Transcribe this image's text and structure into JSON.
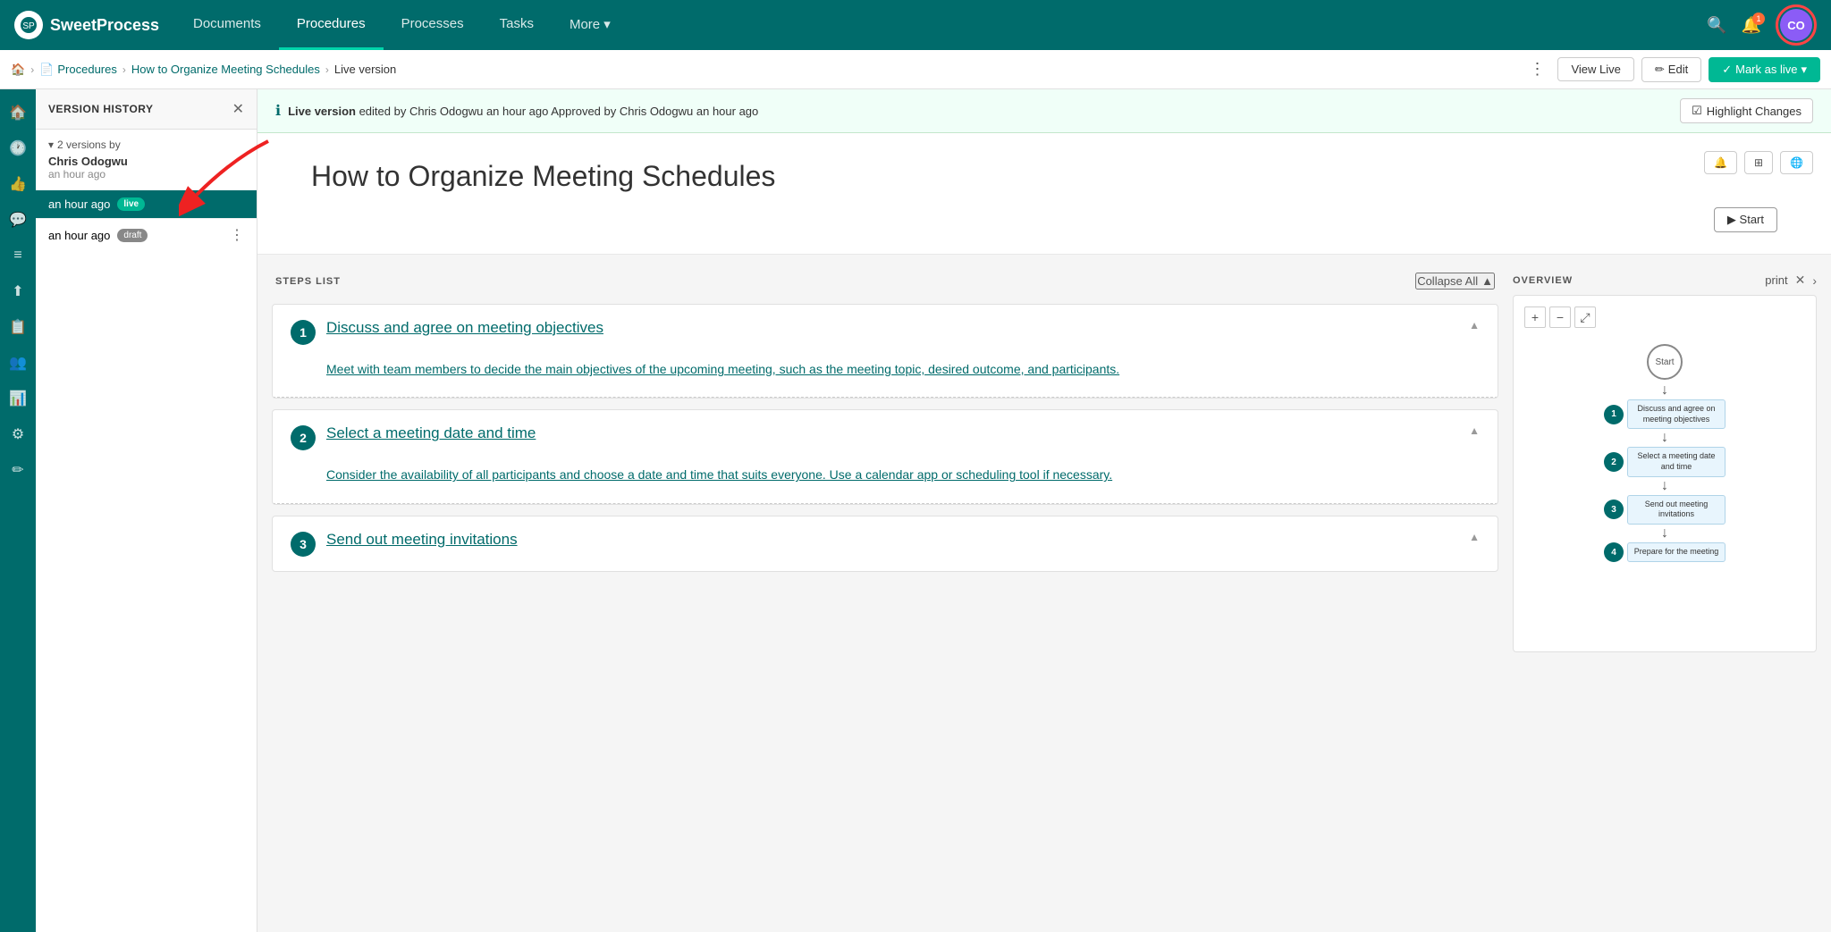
{
  "topnav": {
    "logo": "SweetProcess",
    "links": [
      {
        "label": "Documents",
        "active": false
      },
      {
        "label": "Procedures",
        "active": true
      },
      {
        "label": "Processes",
        "active": false
      },
      {
        "label": "Tasks",
        "active": false
      },
      {
        "label": "More",
        "active": false,
        "hasDropdown": true
      }
    ],
    "notification_count": "1",
    "avatar_initials": "CO"
  },
  "breadcrumb": {
    "home": "Home",
    "procedures": "Procedures",
    "document": "How to Organize Meeting Schedules",
    "current": "Live version"
  },
  "toolbar": {
    "view_live": "View Live",
    "edit": "Edit",
    "mark_as_live": "Mark as live",
    "dots": "⋮"
  },
  "version_panel": {
    "title": "VERSION HISTORY",
    "group_label": "2 versions by",
    "author": "Chris Odogwu",
    "time_ago": "an hour ago",
    "versions": [
      {
        "time": "an hour ago",
        "badge": "live",
        "active": true
      },
      {
        "time": "an hour ago",
        "badge": "draft",
        "active": false
      }
    ]
  },
  "info_banner": {
    "message_prefix": "Live version",
    "message_mid": "edited by Chris Odogwu",
    "message_time1": "an hour ago",
    "message_sep": "Approved by Chris Odogwu",
    "message_time2": "an hour ago",
    "highlight_btn": "Highlight Changes"
  },
  "document": {
    "title": "How to Organize Meeting Schedules",
    "start_btn": "▶ Start"
  },
  "steps": {
    "label": "STEPS LIST",
    "collapse_all": "Collapse All",
    "items": [
      {
        "number": "1",
        "title": "Discuss and agree on meeting objectives",
        "description": "Meet with team members to decide the main objectives of the upcoming meeting, such as the meeting topic, desired outcome, and participants."
      },
      {
        "number": "2",
        "title": "Select a meeting date and time",
        "description": "Consider the availability of all participants and choose a date and time that suits everyone. Use a calendar app or scheduling tool if necessary."
      },
      {
        "number": "3",
        "title": "Send out meeting invitations",
        "description": ""
      }
    ]
  },
  "overview": {
    "title": "OVERVIEW",
    "print": "print",
    "nodes": [
      {
        "number": "1",
        "label": "Discuss and agree on meeting objectives"
      },
      {
        "number": "2",
        "label": "Select a meeting date and time"
      },
      {
        "number": "3",
        "label": "Send out meeting invitations"
      },
      {
        "number": "4",
        "label": "Prepare for the meeting"
      }
    ]
  },
  "icon_sidebar": [
    "🏠",
    "🕐",
    "👍",
    "💬",
    "≡",
    "⬆",
    "📋",
    "👥",
    "📊",
    "⚙",
    "✏"
  ]
}
